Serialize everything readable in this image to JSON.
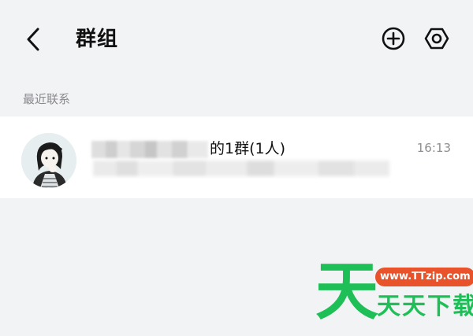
{
  "header": {
    "title": "群组"
  },
  "section": {
    "recent_label": "最近联系"
  },
  "groups": [
    {
      "name_suffix": "的1群(1人)",
      "time": "16:13"
    }
  ],
  "watermark": {
    "big_char": "天",
    "url": "www.TTzip.com",
    "text": "天天下载"
  },
  "colors": {
    "background": "#f2f3f5",
    "watermark_green": "#1fbf57",
    "watermark_orange": "#e8532b"
  },
  "icons": {
    "back": "chevron-left-icon",
    "add": "plus-circle-icon",
    "settings": "hexagon-settings-icon"
  }
}
